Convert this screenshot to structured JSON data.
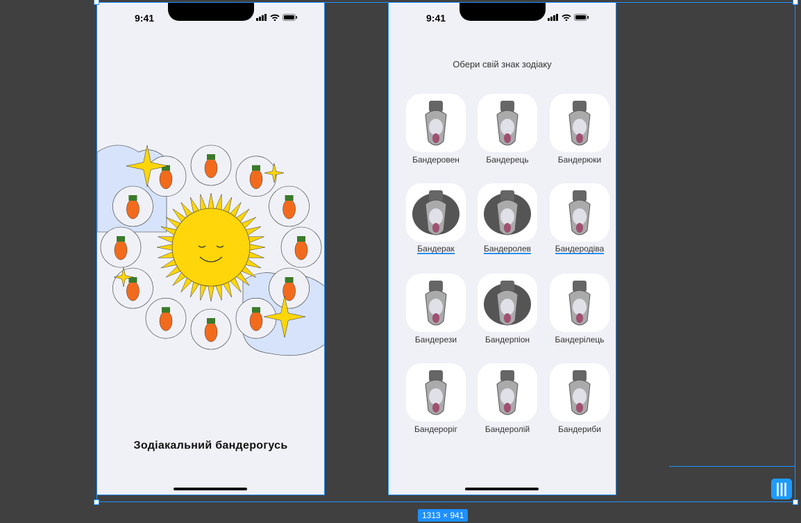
{
  "canvas": {
    "dimensions_label": "1313 × 941",
    "background": "#404040",
    "selection_color": "#1e90ff"
  },
  "screen1": {
    "time": "9:41",
    "title": "Зодіакальний бандерогусь",
    "illustration": "sun-zodiac-wheel",
    "colors": {
      "sun": "#ffd60a",
      "cloud": "#d6e3fb"
    }
  },
  "screen2": {
    "time": "9:41",
    "subtitle": "Обери свій знак зодіаку",
    "signs": [
      {
        "label": "Бандеровен",
        "icon": "ram-goose-icon"
      },
      {
        "label": "Бандерець",
        "icon": "bull-goose-icon"
      },
      {
        "label": "Бандерюки",
        "icon": "twins-goose-icon"
      },
      {
        "label": "Бандерак",
        "icon": "crab-goose-icon",
        "underlined": true
      },
      {
        "label": "Бандеролев",
        "icon": "lion-goose-icon",
        "underlined": true
      },
      {
        "label": "Бандеродіва",
        "icon": "virgo-goose-icon",
        "underlined": true
      },
      {
        "label": "Бандерези",
        "icon": "scales-goose-icon"
      },
      {
        "label": "Бандерпіон",
        "icon": "scorpion-goose-icon"
      },
      {
        "label": "Бандерілець",
        "icon": "archer-goose-icon"
      },
      {
        "label": "Бандероріг",
        "icon": "capricorn-goose-icon"
      },
      {
        "label": "Бандеролій",
        "icon": "aquarius-goose-icon"
      },
      {
        "label": "Бандериби",
        "icon": "fish-goose-icon"
      }
    ]
  }
}
